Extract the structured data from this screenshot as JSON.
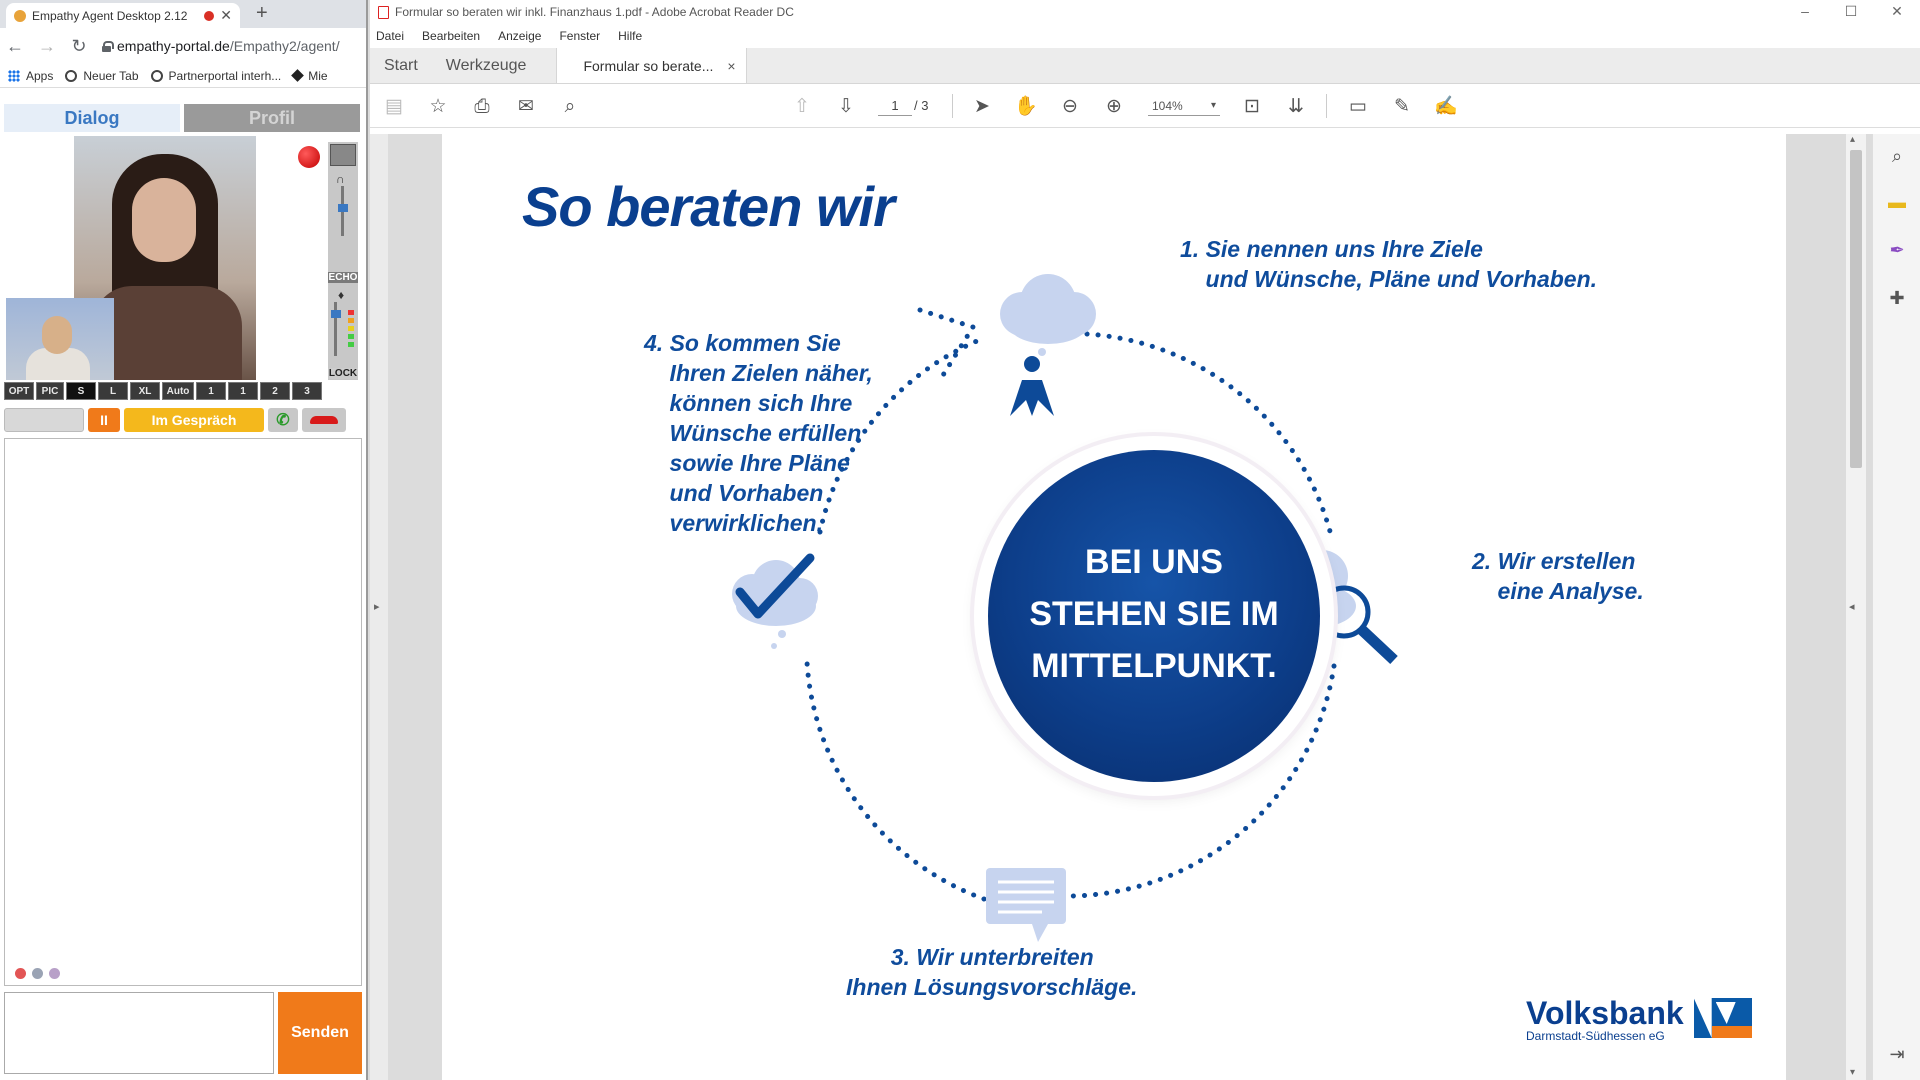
{
  "browser": {
    "tab_title": "Empathy Agent Desktop 2.12",
    "tab_close": "✕",
    "new_tab": "+",
    "url_host": "empathy-portal.de",
    "url_path": "/Empathy2/agent/",
    "bookmarks": [
      "Apps",
      "Neuer Tab",
      "Partnerportal interh...",
      "Mie"
    ]
  },
  "agent": {
    "tabs": [
      "Dialog",
      "Profil"
    ],
    "side_labels": [
      "ECHO",
      "LOCK"
    ],
    "opt_buttons": [
      "OPT",
      "PIC",
      "S",
      "L",
      "XL",
      "Auto",
      "1",
      "1",
      "2",
      "3"
    ],
    "pause_label": "II",
    "status_label": "Im Gespräch",
    "accept_glyph": "✆",
    "send_label": "Senden"
  },
  "acrobat": {
    "window_title": "Formular so beraten wir inkl. Finanzhaus 1.pdf - Adobe Acrobat Reader DC",
    "window_controls": [
      "–",
      "☐",
      "✕"
    ],
    "menu": [
      "Datei",
      "Bearbeiten",
      "Anzeige",
      "Fenster",
      "Hilfe"
    ],
    "tabs": [
      "Start",
      "Werkzeuge"
    ],
    "doc_tab": "Formular so berate...",
    "doc_tab_close": "×",
    "current_page": "1",
    "total_pages": "/ 3",
    "zoom": "104%",
    "zoom_dropdown": "▾"
  },
  "document": {
    "title": "So beraten wir",
    "center_text": "BEI UNS\nSTEHEN SIE IM\nMITTELPUNKT.",
    "step1": "1. Sie nennen uns Ihre Ziele\n    und Wünsche, Pläne und Vorhaben.",
    "step2": "2. Wir erstellen\n    eine Analyse.",
    "step3": "       3. Wir unterbreiten\nIhnen Lösungsvorschläge.",
    "step4": "4. So kommen Sie\n    Ihren Zielen näher,\n    können sich Ihre\n    Wünsche erfüllen\n    sowie Ihre Pläne\n    und Vorhaben\n    verwirklichen.",
    "logo_name": "Volksbank",
    "logo_sub": "Darmstadt-Südhessen eG"
  },
  "colors": {
    "accent_blue": "#0a3f8f",
    "send_orange": "#f07a1a",
    "status_yellow": "#f4b81c",
    "record_red": "#d81a1a"
  }
}
